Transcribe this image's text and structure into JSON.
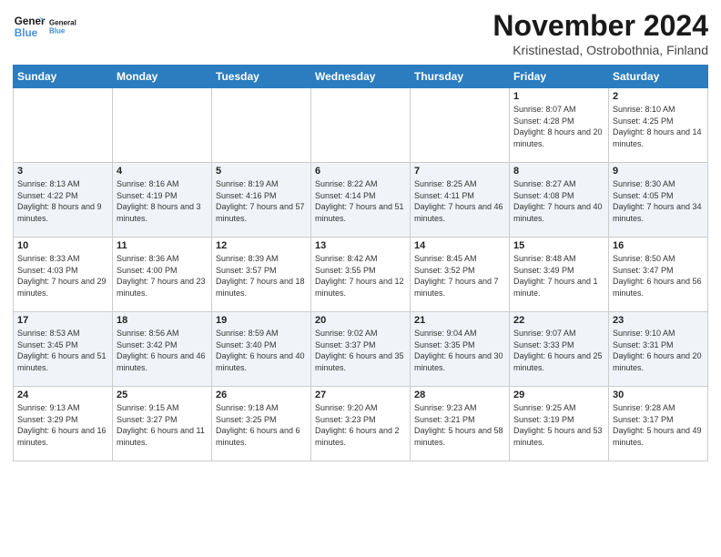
{
  "logo": {
    "line1": "General",
    "line2": "Blue"
  },
  "title": "November 2024",
  "location": "Kristinestad, Ostrobothnia, Finland",
  "weekdays": [
    "Sunday",
    "Monday",
    "Tuesday",
    "Wednesday",
    "Thursday",
    "Friday",
    "Saturday"
  ],
  "weeks": [
    [
      {
        "day": "",
        "sunrise": "",
        "sunset": "",
        "daylight": ""
      },
      {
        "day": "",
        "sunrise": "",
        "sunset": "",
        "daylight": ""
      },
      {
        "day": "",
        "sunrise": "",
        "sunset": "",
        "daylight": ""
      },
      {
        "day": "",
        "sunrise": "",
        "sunset": "",
        "daylight": ""
      },
      {
        "day": "",
        "sunrise": "",
        "sunset": "",
        "daylight": ""
      },
      {
        "day": "1",
        "sunrise": "Sunrise: 8:07 AM",
        "sunset": "Sunset: 4:28 PM",
        "daylight": "Daylight: 8 hours and 20 minutes."
      },
      {
        "day": "2",
        "sunrise": "Sunrise: 8:10 AM",
        "sunset": "Sunset: 4:25 PM",
        "daylight": "Daylight: 8 hours and 14 minutes."
      }
    ],
    [
      {
        "day": "3",
        "sunrise": "Sunrise: 8:13 AM",
        "sunset": "Sunset: 4:22 PM",
        "daylight": "Daylight: 8 hours and 9 minutes."
      },
      {
        "day": "4",
        "sunrise": "Sunrise: 8:16 AM",
        "sunset": "Sunset: 4:19 PM",
        "daylight": "Daylight: 8 hours and 3 minutes."
      },
      {
        "day": "5",
        "sunrise": "Sunrise: 8:19 AM",
        "sunset": "Sunset: 4:16 PM",
        "daylight": "Daylight: 7 hours and 57 minutes."
      },
      {
        "day": "6",
        "sunrise": "Sunrise: 8:22 AM",
        "sunset": "Sunset: 4:14 PM",
        "daylight": "Daylight: 7 hours and 51 minutes."
      },
      {
        "day": "7",
        "sunrise": "Sunrise: 8:25 AM",
        "sunset": "Sunset: 4:11 PM",
        "daylight": "Daylight: 7 hours and 46 minutes."
      },
      {
        "day": "8",
        "sunrise": "Sunrise: 8:27 AM",
        "sunset": "Sunset: 4:08 PM",
        "daylight": "Daylight: 7 hours and 40 minutes."
      },
      {
        "day": "9",
        "sunrise": "Sunrise: 8:30 AM",
        "sunset": "Sunset: 4:05 PM",
        "daylight": "Daylight: 7 hours and 34 minutes."
      }
    ],
    [
      {
        "day": "10",
        "sunrise": "Sunrise: 8:33 AM",
        "sunset": "Sunset: 4:03 PM",
        "daylight": "Daylight: 7 hours and 29 minutes."
      },
      {
        "day": "11",
        "sunrise": "Sunrise: 8:36 AM",
        "sunset": "Sunset: 4:00 PM",
        "daylight": "Daylight: 7 hours and 23 minutes."
      },
      {
        "day": "12",
        "sunrise": "Sunrise: 8:39 AM",
        "sunset": "Sunset: 3:57 PM",
        "daylight": "Daylight: 7 hours and 18 minutes."
      },
      {
        "day": "13",
        "sunrise": "Sunrise: 8:42 AM",
        "sunset": "Sunset: 3:55 PM",
        "daylight": "Daylight: 7 hours and 12 minutes."
      },
      {
        "day": "14",
        "sunrise": "Sunrise: 8:45 AM",
        "sunset": "Sunset: 3:52 PM",
        "daylight": "Daylight: 7 hours and 7 minutes."
      },
      {
        "day": "15",
        "sunrise": "Sunrise: 8:48 AM",
        "sunset": "Sunset: 3:49 PM",
        "daylight": "Daylight: 7 hours and 1 minute."
      },
      {
        "day": "16",
        "sunrise": "Sunrise: 8:50 AM",
        "sunset": "Sunset: 3:47 PM",
        "daylight": "Daylight: 6 hours and 56 minutes."
      }
    ],
    [
      {
        "day": "17",
        "sunrise": "Sunrise: 8:53 AM",
        "sunset": "Sunset: 3:45 PM",
        "daylight": "Daylight: 6 hours and 51 minutes."
      },
      {
        "day": "18",
        "sunrise": "Sunrise: 8:56 AM",
        "sunset": "Sunset: 3:42 PM",
        "daylight": "Daylight: 6 hours and 46 minutes."
      },
      {
        "day": "19",
        "sunrise": "Sunrise: 8:59 AM",
        "sunset": "Sunset: 3:40 PM",
        "daylight": "Daylight: 6 hours and 40 minutes."
      },
      {
        "day": "20",
        "sunrise": "Sunrise: 9:02 AM",
        "sunset": "Sunset: 3:37 PM",
        "daylight": "Daylight: 6 hours and 35 minutes."
      },
      {
        "day": "21",
        "sunrise": "Sunrise: 9:04 AM",
        "sunset": "Sunset: 3:35 PM",
        "daylight": "Daylight: 6 hours and 30 minutes."
      },
      {
        "day": "22",
        "sunrise": "Sunrise: 9:07 AM",
        "sunset": "Sunset: 3:33 PM",
        "daylight": "Daylight: 6 hours and 25 minutes."
      },
      {
        "day": "23",
        "sunrise": "Sunrise: 9:10 AM",
        "sunset": "Sunset: 3:31 PM",
        "daylight": "Daylight: 6 hours and 20 minutes."
      }
    ],
    [
      {
        "day": "24",
        "sunrise": "Sunrise: 9:13 AM",
        "sunset": "Sunset: 3:29 PM",
        "daylight": "Daylight: 6 hours and 16 minutes."
      },
      {
        "day": "25",
        "sunrise": "Sunrise: 9:15 AM",
        "sunset": "Sunset: 3:27 PM",
        "daylight": "Daylight: 6 hours and 11 minutes."
      },
      {
        "day": "26",
        "sunrise": "Sunrise: 9:18 AM",
        "sunset": "Sunset: 3:25 PM",
        "daylight": "Daylight: 6 hours and 6 minutes."
      },
      {
        "day": "27",
        "sunrise": "Sunrise: 9:20 AM",
        "sunset": "Sunset: 3:23 PM",
        "daylight": "Daylight: 6 hours and 2 minutes."
      },
      {
        "day": "28",
        "sunrise": "Sunrise: 9:23 AM",
        "sunset": "Sunset: 3:21 PM",
        "daylight": "Daylight: 5 hours and 58 minutes."
      },
      {
        "day": "29",
        "sunrise": "Sunrise: 9:25 AM",
        "sunset": "Sunset: 3:19 PM",
        "daylight": "Daylight: 5 hours and 53 minutes."
      },
      {
        "day": "30",
        "sunrise": "Sunrise: 9:28 AM",
        "sunset": "Sunset: 3:17 PM",
        "daylight": "Daylight: 5 hours and 49 minutes."
      }
    ]
  ]
}
